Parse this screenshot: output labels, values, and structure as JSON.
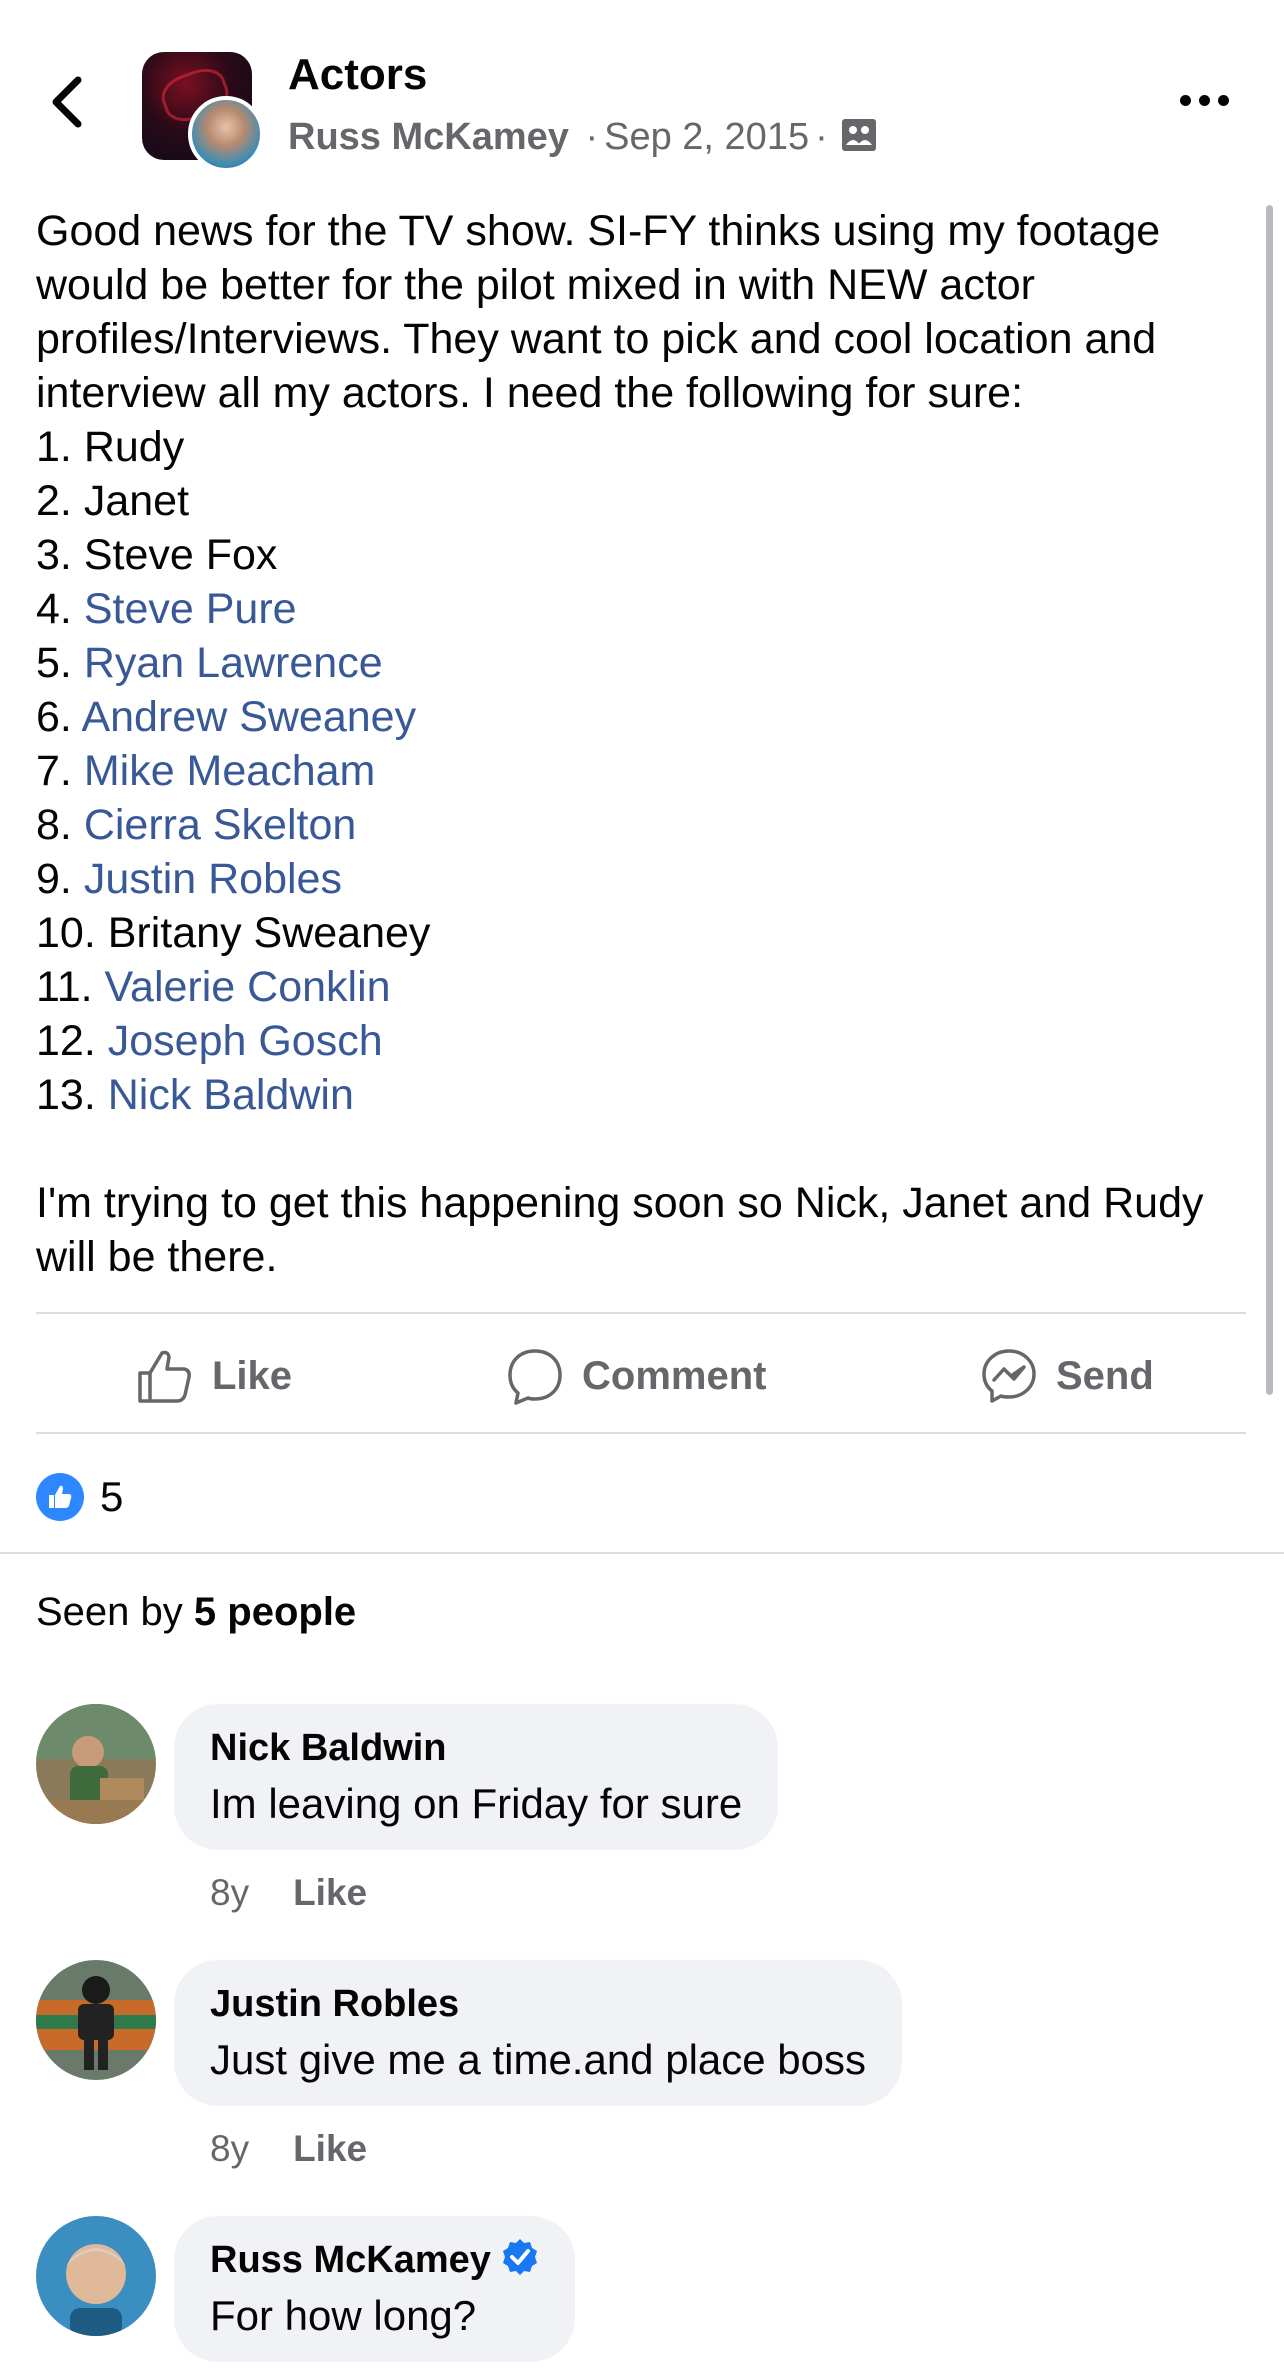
{
  "header": {
    "title": "Actors",
    "author": "Russ McKamey",
    "date": "Sep 2, 2015",
    "separator": "·"
  },
  "post": {
    "intro": "Good news for the TV show. SI-FY thinks using my footage would be better for the pilot mixed in with NEW actor profiles/Interviews. They want to pick and cool location and interview all my actors. I need the following for sure:",
    "list": [
      {
        "num": "1.",
        "name": "Rudy",
        "linked": false
      },
      {
        "num": "2.",
        "name": "Janet",
        "linked": false
      },
      {
        "num": "3.",
        "name": "Steve Fox",
        "linked": false
      },
      {
        "num": "4.",
        "name": "Steve Pure",
        "linked": true
      },
      {
        "num": "5.",
        "name": "Ryan Lawrence",
        "linked": true
      },
      {
        "num": "6.",
        "name": "Andrew Sweaney",
        "linked": true
      },
      {
        "num": "7.",
        "name": "Mike Meacham",
        "linked": true
      },
      {
        "num": "8.",
        "name": "Cierra Skelton",
        "linked": true
      },
      {
        "num": "9.",
        "name": "Justin Robles",
        "linked": true
      },
      {
        "num": "10.",
        "name": "Britany Sweaney",
        "linked": false
      },
      {
        "num": "11.",
        "name": "Valerie Conklin",
        "linked": true
      },
      {
        "num": "12.",
        "name": "Joseph Gosch",
        "linked": true
      },
      {
        "num": "13.",
        "name": "Nick Baldwin",
        "linked": true
      }
    ],
    "outro": "I'm trying to get this happening soon so Nick, Janet and Rudy will be there."
  },
  "actions": {
    "like": "Like",
    "comment": "Comment",
    "send": "Send"
  },
  "reactions": {
    "count": "5"
  },
  "seen_by": {
    "prefix": "Seen by",
    "count": "5 people"
  },
  "comments": [
    {
      "name": "Nick Baldwin",
      "text": "Im leaving on Friday for sure",
      "time": "8y",
      "like": "Like",
      "verified": false
    },
    {
      "name": "Justin Robles",
      "text": "Just give me a time.and place boss",
      "time": "8y",
      "like": "Like",
      "verified": false
    },
    {
      "name": "Russ McKamey",
      "text": "For how long?",
      "verified": true
    }
  ],
  "colors": {
    "link": "#385898",
    "secondary_text": "#65676b",
    "bubble_bg": "#f0f2f5",
    "like_blue": "#2d88ff",
    "verified_blue": "#1877f2"
  },
  "icons": [
    "back-arrow-icon",
    "more-icon",
    "group-icon",
    "like-icon",
    "comment-icon",
    "messenger-icon",
    "like-reaction-icon",
    "verified-badge-icon"
  ]
}
